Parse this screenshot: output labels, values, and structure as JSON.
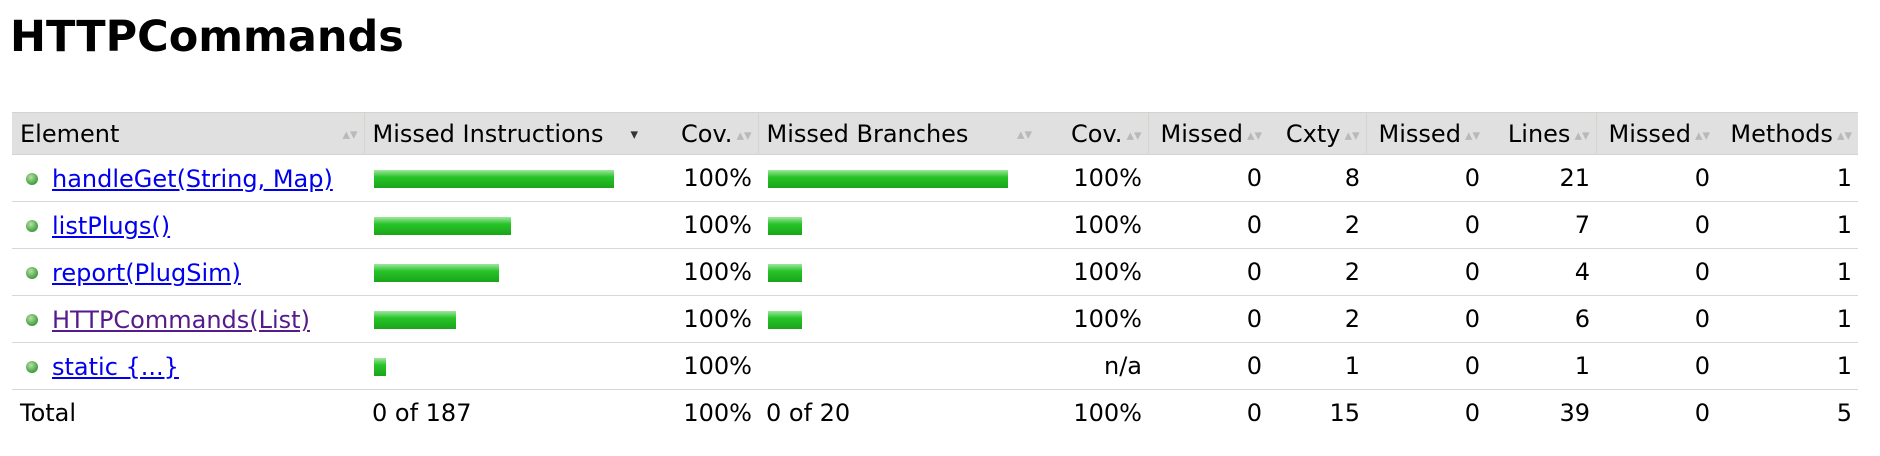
{
  "page": {
    "title": "HTTPCommands"
  },
  "table": {
    "headers": {
      "element": "Element",
      "missed_instructions": "Missed Instructions",
      "cov1": "Cov.",
      "missed_branches": "Missed Branches",
      "cov2": "Cov.",
      "missed_cxty": "Missed",
      "cxty": "Cxty",
      "missed_lines": "Missed",
      "lines": "Lines",
      "missed_methods": "Missed",
      "methods": "Methods"
    },
    "sort_glyph": "▴▾",
    "sort_active_glyph": "▾",
    "rows": [
      {
        "element": "handleGet(String, Map)",
        "instr_fraction": 1.0,
        "instr_cov": "100%",
        "branch_fraction": 1.0,
        "branch_cov": "100%",
        "missed_cxty": "0",
        "cxty": "8",
        "missed_lines": "0",
        "lines": "21",
        "missed_methods": "0",
        "methods": "1",
        "visited": false
      },
      {
        "element": "listPlugs()",
        "instr_fraction": 0.57,
        "instr_cov": "100%",
        "branch_fraction": 0.14,
        "branch_cov": "100%",
        "missed_cxty": "0",
        "cxty": "2",
        "missed_lines": "0",
        "lines": "7",
        "missed_methods": "0",
        "methods": "1",
        "visited": false
      },
      {
        "element": "report(PlugSim)",
        "instr_fraction": 0.52,
        "instr_cov": "100%",
        "branch_fraction": 0.14,
        "branch_cov": "100%",
        "missed_cxty": "0",
        "cxty": "2",
        "missed_lines": "0",
        "lines": "4",
        "missed_methods": "0",
        "methods": "1",
        "visited": false
      },
      {
        "element": "HTTPCommands(List)",
        "instr_fraction": 0.34,
        "instr_cov": "100%",
        "branch_fraction": 0.14,
        "branch_cov": "100%",
        "missed_cxty": "0",
        "cxty": "2",
        "missed_lines": "0",
        "lines": "6",
        "missed_methods": "0",
        "methods": "1",
        "visited": true
      },
      {
        "element": "static {...}",
        "instr_fraction": 0.05,
        "instr_cov": "100%",
        "branch_fraction": 0,
        "branch_cov": "n/a",
        "missed_cxty": "0",
        "cxty": "1",
        "missed_lines": "0",
        "lines": "1",
        "missed_methods": "0",
        "methods": "1",
        "visited": false
      }
    ],
    "total": {
      "label": "Total",
      "instructions": "0 of 187",
      "instr_cov": "100%",
      "branches": "0 of 20",
      "branch_cov": "100%",
      "missed_cxty": "0",
      "cxty": "15",
      "missed_lines": "0",
      "lines": "39",
      "missed_methods": "0",
      "methods": "5"
    }
  },
  "colors": {
    "bar_green": "#1aa31a",
    "header_bg": "#e0e0e0",
    "link": "#0000ee",
    "visited_link": "#551a8b"
  }
}
